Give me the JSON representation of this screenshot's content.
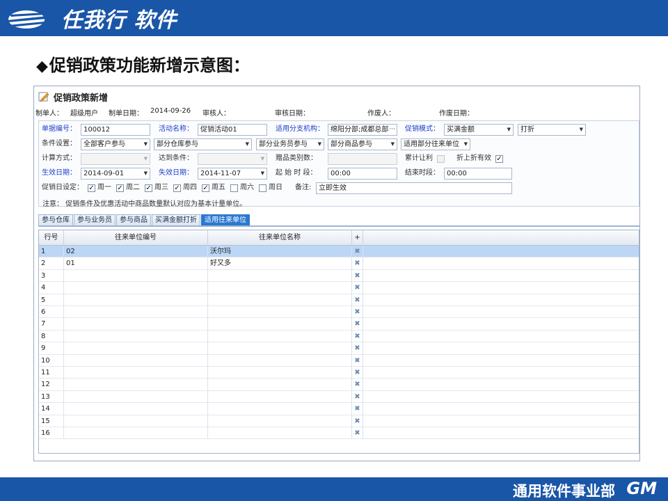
{
  "slide": {
    "logo_text": "任我行 软件",
    "title": "促销政策功能新增示意图：",
    "footer_text": "通用软件事业部",
    "footer_brand": "GM"
  },
  "window": {
    "title": "促销政策新增",
    "meta": {
      "creator_label": "制单人：",
      "creator_value": "超级用户",
      "date_label": "制单日期：",
      "date_value": "2014-09-26",
      "auditor_label": "审核人：",
      "audit_date_label": "审核日期：",
      "voider_label": "作废人：",
      "void_date_label": "作废日期："
    }
  },
  "form": {
    "doc_no_label": "单据编号：",
    "doc_no_value": "100012",
    "activity_label": "活动名称：",
    "activity_value": "促销活动01",
    "branch_label": "适用分支机构：",
    "branch_value": "绵阳分部;成都总部",
    "promo_mode_label": "促销模式：",
    "promo_mode_value": "买满金额",
    "promo_type_value": "打折",
    "condition_label": "条件设置：",
    "customer_value": "全部客户参与",
    "warehouse_value": "部分仓库参与",
    "salesman_value": "部分业务员参与",
    "goods_value": "部分商品参与",
    "partner_value": "适用部分往来单位",
    "calc_label": "计算方式：",
    "calc_value": "",
    "reach_label": "达到条件：",
    "reach_value": "",
    "gift_count_label": "赠品类别数：",
    "gift_count_value": "",
    "cumulative_label": "累计让利",
    "discount_valid_label": "折上折有效",
    "effective_label": "生效日期：",
    "effective_value": "2014-09-01",
    "expire_label": "失效日期：",
    "expire_value": "2014-11-07",
    "start_time_label": "起 始 时 段：",
    "start_time_value": "00:00",
    "end_time_label": "结束时段：",
    "end_time_value": "00:00",
    "weekday_label": "促销日设定：",
    "weekdays": [
      {
        "label": "周一",
        "checked": true
      },
      {
        "label": "周二",
        "checked": true
      },
      {
        "label": "周三",
        "checked": true
      },
      {
        "label": "周四",
        "checked": true
      },
      {
        "label": "周五",
        "checked": true
      },
      {
        "label": "周六",
        "checked": false
      },
      {
        "label": "周日",
        "checked": false
      }
    ],
    "remark_label": "备注:",
    "remark_value": "立即生效",
    "note": "注意： 促销条件及优惠活动中商品数量默认对应为基本计量单位。"
  },
  "tabs": [
    {
      "label": "参与仓库",
      "active": false
    },
    {
      "label": "参与业务员",
      "active": false
    },
    {
      "label": "参与商品",
      "active": false
    },
    {
      "label": "买满金额打折",
      "active": false
    },
    {
      "label": "适用往来单位",
      "active": true
    }
  ],
  "grid": {
    "columns": [
      "行号",
      "往来单位编号",
      "往来单位名称",
      "+"
    ],
    "rows": [
      {
        "no": "1",
        "code": "02",
        "name": "沃尔玛",
        "selected": true
      },
      {
        "no": "2",
        "code": "01",
        "name": "好又多",
        "selected": false
      },
      {
        "no": "3",
        "code": "",
        "name": "",
        "selected": false
      },
      {
        "no": "4",
        "code": "",
        "name": "",
        "selected": false
      },
      {
        "no": "5",
        "code": "",
        "name": "",
        "selected": false
      },
      {
        "no": "6",
        "code": "",
        "name": "",
        "selected": false
      },
      {
        "no": "7",
        "code": "",
        "name": "",
        "selected": false
      },
      {
        "no": "8",
        "code": "",
        "name": "",
        "selected": false
      },
      {
        "no": "9",
        "code": "",
        "name": "",
        "selected": false
      },
      {
        "no": "10",
        "code": "",
        "name": "",
        "selected": false
      },
      {
        "no": "11",
        "code": "",
        "name": "",
        "selected": false
      },
      {
        "no": "12",
        "code": "",
        "name": "",
        "selected": false
      },
      {
        "no": "13",
        "code": "",
        "name": "",
        "selected": false
      },
      {
        "no": "14",
        "code": "",
        "name": "",
        "selected": false
      },
      {
        "no": "15",
        "code": "",
        "name": "",
        "selected": false
      },
      {
        "no": "16",
        "code": "",
        "name": "",
        "selected": false
      }
    ]
  }
}
